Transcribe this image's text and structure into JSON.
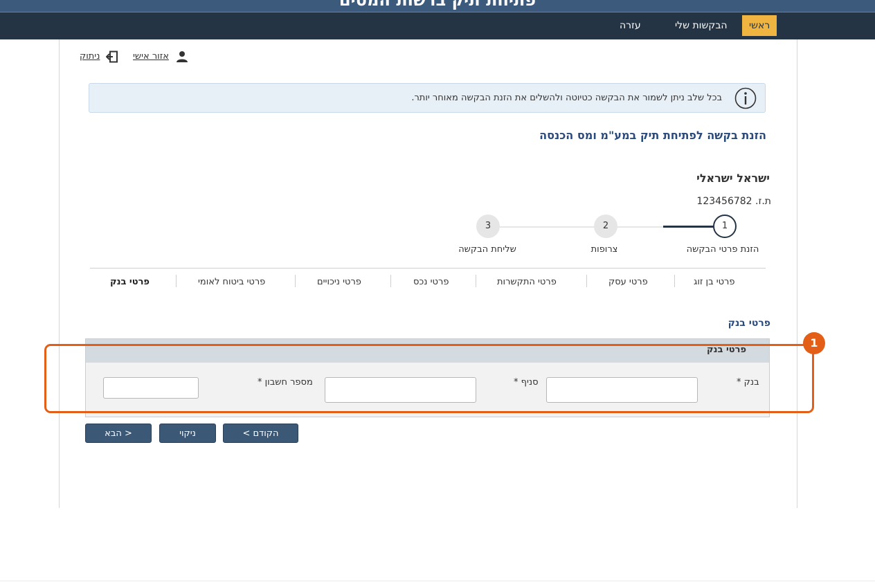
{
  "header": {
    "title": "פתיחת תיק ברשות המסים"
  },
  "nav": {
    "home": "ראשי",
    "my_requests": "הבקשות שלי",
    "help": "עזרה"
  },
  "top_links": {
    "personal_area": "אזור אישי",
    "logout": "ניתוק"
  },
  "info": {
    "text": "בכל שלב ניתן לשמור את הבקשה כטיוטה ולהשלים את הזנת הבקשה מאוחר יותר."
  },
  "page_title": "הזנת בקשה לפתיחת תיק במע\"מ ומס הכנסה",
  "person": {
    "name": "ישראל ישראלי",
    "id_label": "ת.ז.",
    "id_value": "123456782"
  },
  "steps": [
    {
      "num": "1",
      "label": "הזנת פרטי הבקשה",
      "state": "active"
    },
    {
      "num": "2",
      "label": "צרופות",
      "state": "pending"
    },
    {
      "num": "3",
      "label": "שליחת הבקשה",
      "state": "pending"
    }
  ],
  "tabs": [
    {
      "label": "פרטי בן זוג"
    },
    {
      "label": "פרטי עסק"
    },
    {
      "label": "פרטי התקשרות"
    },
    {
      "label": "פרטי נכס"
    },
    {
      "label": "פרטי ניכויים"
    },
    {
      "label": "פרטי ביטוח לאומי"
    },
    {
      "label": "פרטי בנק",
      "active": true
    }
  ],
  "section": {
    "title": "פרטי בנק",
    "panel_title": "פרטי בנק",
    "fields": {
      "bank": {
        "label": "בנק",
        "required_mark": "*",
        "value": ""
      },
      "branch": {
        "label": "סניף",
        "required_mark": "*",
        "value": ""
      },
      "account": {
        "label": "מספר חשבון",
        "required_mark": "*",
        "value": ""
      }
    }
  },
  "annotation": {
    "badge": "1",
    "color": "#e35f17"
  },
  "buttons": {
    "prev": "< הקודם",
    "clear": "ניקוי",
    "next": "הבא >"
  },
  "colors": {
    "nav_bg": "#243445",
    "nav_active": "#f0b541",
    "title_blue": "#2b4a7c",
    "button_bg": "#3b5877"
  }
}
